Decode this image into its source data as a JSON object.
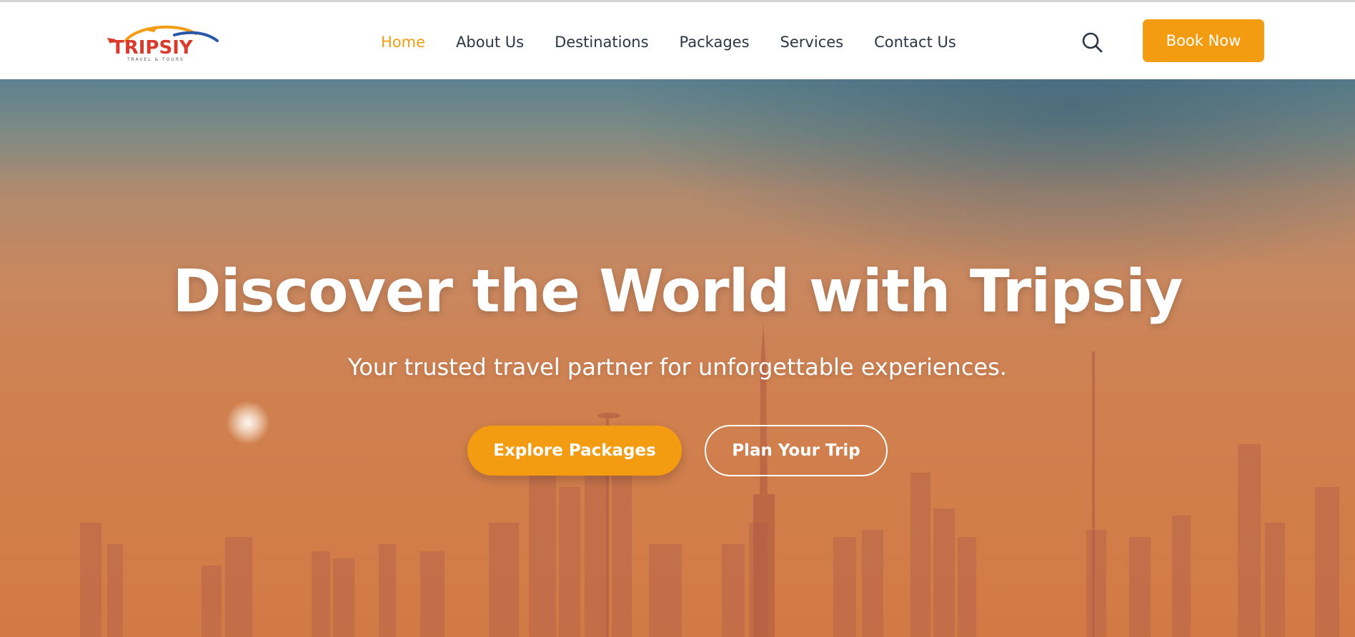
{
  "brand": {
    "name": "TRIPSIY",
    "tagline": "TRAVEL & TOURS",
    "colors": {
      "accent": "#f39c12",
      "logo_red": "#d93a2b",
      "logo_blue": "#2a57a8"
    }
  },
  "nav": {
    "items": [
      {
        "label": "Home",
        "active": true
      },
      {
        "label": "About Us"
      },
      {
        "label": "Destinations"
      },
      {
        "label": "Packages"
      },
      {
        "label": "Services"
      },
      {
        "label": "Contact Us"
      }
    ],
    "search_icon": "search-icon",
    "book_label": "Book Now"
  },
  "hero": {
    "title": "Discover the World with Tripsiy",
    "subtitle": "Your trusted travel partner for unforgettable experiences.",
    "primary_cta": "Explore Packages",
    "secondary_cta": "Plan Your Trip"
  }
}
